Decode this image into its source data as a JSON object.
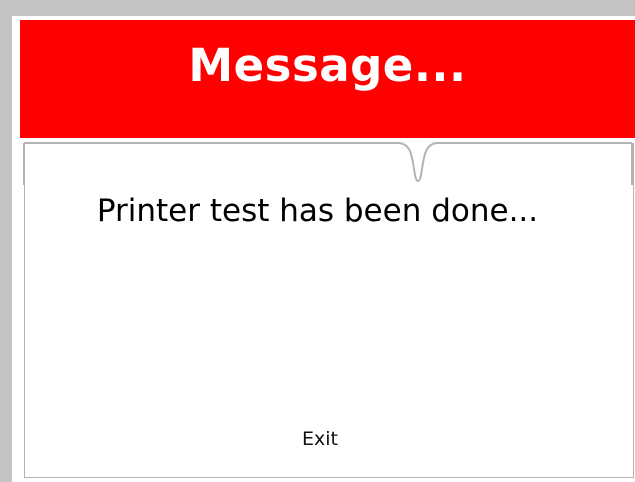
{
  "dialog": {
    "title": "Message...",
    "message": "Printer test has been done...",
    "exit_label": "Exit"
  },
  "colors": {
    "header_background": "#ff0000",
    "header_text": "#ffffff",
    "body_background": "#ffffff",
    "border": "#b3b3b3",
    "frame": "#c3c3c3"
  }
}
